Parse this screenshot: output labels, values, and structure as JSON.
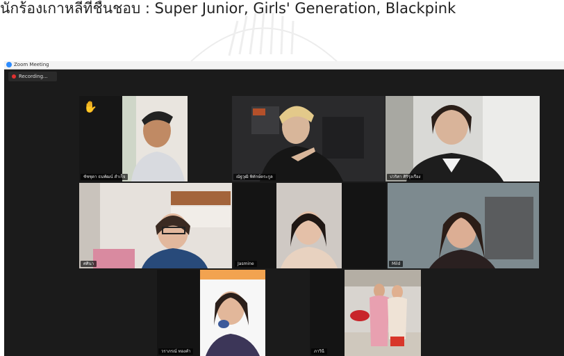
{
  "document": {
    "caption": "นักร้องเกาหลีที่ชื่นชอบ : Super Junior, Girls' Generation, Blackpink"
  },
  "window": {
    "title": "Zoom Meeting",
    "recording_label": "Recording..."
  },
  "participants": [
    {
      "name": "ชัชชุดา ธนพัฒน์ สำเร็จ",
      "raised_hand": true,
      "active_speaker": false
    },
    {
      "name": "ณัฐวุฒิ พิทักษ์ตระกูล",
      "raised_hand": false,
      "active_speaker": false
    },
    {
      "name": "ปวริศา ศิริรุ่งเรือง",
      "raised_hand": false,
      "active_speaker": true
    },
    {
      "name": "ศศินา",
      "raised_hand": false,
      "active_speaker": false
    },
    {
      "name": "Jasmine",
      "raised_hand": false,
      "active_speaker": false
    },
    {
      "name": "Mild",
      "raised_hand": false,
      "active_speaker": false
    },
    {
      "name": "วราภรณ์ ทองคำ",
      "raised_hand": false,
      "active_speaker": false
    },
    {
      "name": "ภาวินี",
      "raised_hand": false,
      "active_speaker": false
    }
  ],
  "colors": {
    "grid_background": "#1b1b1b",
    "active_speaker_border": "#c8dd6a",
    "record_dot": "#e03030",
    "raised_hand": "#f5b800"
  }
}
